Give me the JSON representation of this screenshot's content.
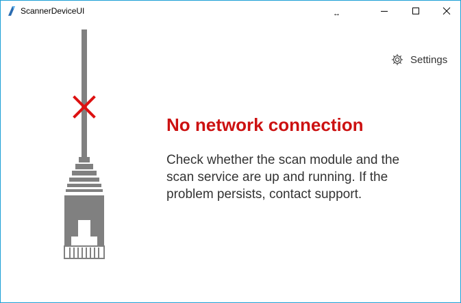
{
  "window": {
    "title": "ScannerDeviceUI",
    "resize_cursor": "↔"
  },
  "settings": {
    "label": "Settings",
    "icon": "gear-icon"
  },
  "status": {
    "headline": "No network connection",
    "message": "Check whether the scan module and the scan service are up and running. If the problem persists, contact support."
  },
  "colors": {
    "error_red": "#cc1111",
    "window_border": "#1b9fd6",
    "cable_gray": "#808080",
    "text_dark": "#333333"
  }
}
